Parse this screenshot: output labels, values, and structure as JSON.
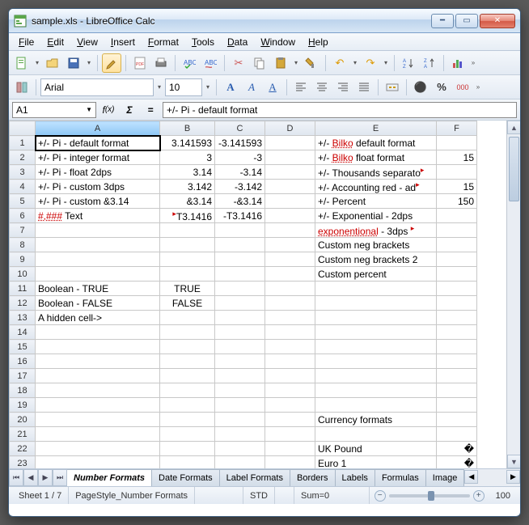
{
  "window": {
    "title": "sample.xls - LibreOffice Calc"
  },
  "menu": [
    "File",
    "Edit",
    "View",
    "Insert",
    "Format",
    "Tools",
    "Data",
    "Window",
    "Help"
  ],
  "font": {
    "name": "Arial",
    "size": "10"
  },
  "cell_ref": "A1",
  "formula": "+/- Pi - default format",
  "columns": [
    "",
    "A",
    "B",
    "C",
    "D",
    "E",
    "F"
  ],
  "rows": [
    {
      "n": 1,
      "A": "+/- Pi - default format",
      "B": "3.141593",
      "C": "-3.141593",
      "D": "",
      "E": "+/- Bilko default format",
      "F": ""
    },
    {
      "n": 2,
      "A": "+/- Pi - integer format",
      "B": "3",
      "C": "-3",
      "D": "",
      "E": "+/- Bilko float format",
      "F": "15"
    },
    {
      "n": 3,
      "A": "+/- Pi - float 2dps",
      "B": "3.14",
      "C": "-3.14",
      "D": "",
      "E": "+/- Thousands separato",
      "F": ""
    },
    {
      "n": 4,
      "A": "+/- Pi - custom 3dps",
      "B": "3.142",
      "C": "-3.142",
      "D": "",
      "E": "+/- Accounting red - ad",
      "F": "15"
    },
    {
      "n": 5,
      "A": "+/- Pi - custom &3.14",
      "B": "&3.14",
      "C": "-&3.14",
      "D": "",
      "E": "+/- Percent",
      "F": "150"
    },
    {
      "n": 6,
      "A": "#,### Text",
      "B": "T3.1416",
      "C": "-T3.1416",
      "D": "",
      "E": "+/- Exponential - 2dps",
      "F": ""
    },
    {
      "n": 7,
      "A": "",
      "B": "",
      "C": "",
      "D": "",
      "E": "exponentional - 3dps",
      "F": ""
    },
    {
      "n": 8,
      "A": "",
      "B": "",
      "C": "",
      "D": "",
      "E": "Custom neg brackets",
      "F": ""
    },
    {
      "n": 9,
      "A": "",
      "B": "",
      "C": "",
      "D": "",
      "E": "Custom neg brackets 2",
      "F": ""
    },
    {
      "n": 10,
      "A": "",
      "B": "",
      "C": "",
      "D": "",
      "E": "Custom percent",
      "F": ""
    },
    {
      "n": 11,
      "A": "Boolean - TRUE",
      "B": "TRUE",
      "C": "",
      "D": "",
      "E": "",
      "F": ""
    },
    {
      "n": 12,
      "A": "Boolean - FALSE",
      "B": "FALSE",
      "C": "",
      "D": "",
      "E": "",
      "F": ""
    },
    {
      "n": 13,
      "A": "A hidden cell->",
      "B": "",
      "C": "",
      "D": "",
      "E": "",
      "F": ""
    },
    {
      "n": 14,
      "A": "",
      "B": "",
      "C": "",
      "D": "",
      "E": "",
      "F": ""
    },
    {
      "n": 15,
      "A": "",
      "B": "",
      "C": "",
      "D": "",
      "E": "",
      "F": ""
    },
    {
      "n": 16,
      "A": "",
      "B": "",
      "C": "",
      "D": "",
      "E": "",
      "F": ""
    },
    {
      "n": 17,
      "A": "",
      "B": "",
      "C": "",
      "D": "",
      "E": "",
      "F": ""
    },
    {
      "n": 18,
      "A": "",
      "B": "",
      "C": "",
      "D": "",
      "E": "",
      "F": ""
    },
    {
      "n": 19,
      "A": "",
      "B": "",
      "C": "",
      "D": "",
      "E": "",
      "F": ""
    },
    {
      "n": 20,
      "A": "",
      "B": "",
      "C": "",
      "D": "",
      "E": "Currency formats",
      "F": ""
    },
    {
      "n": 21,
      "A": "",
      "B": "",
      "C": "",
      "D": "",
      "E": "",
      "F": ""
    },
    {
      "n": 22,
      "A": "",
      "B": "",
      "C": "",
      "D": "",
      "E": "UK Pound",
      "F": "�"
    },
    {
      "n": 23,
      "A": "",
      "B": "",
      "C": "",
      "D": "",
      "E": "Euro 1",
      "F": "�"
    }
  ],
  "sheet_tabs": [
    "Number Formats",
    "Date Formats",
    "Label Formats",
    "Borders",
    "Labels",
    "Formulas",
    "Image"
  ],
  "active_tab": 0,
  "status": {
    "sheet": "Sheet 1 / 7",
    "pagestyle": "PageStyle_Number Formats",
    "mode": "STD",
    "sum": "Sum=0",
    "zoom": "100"
  }
}
